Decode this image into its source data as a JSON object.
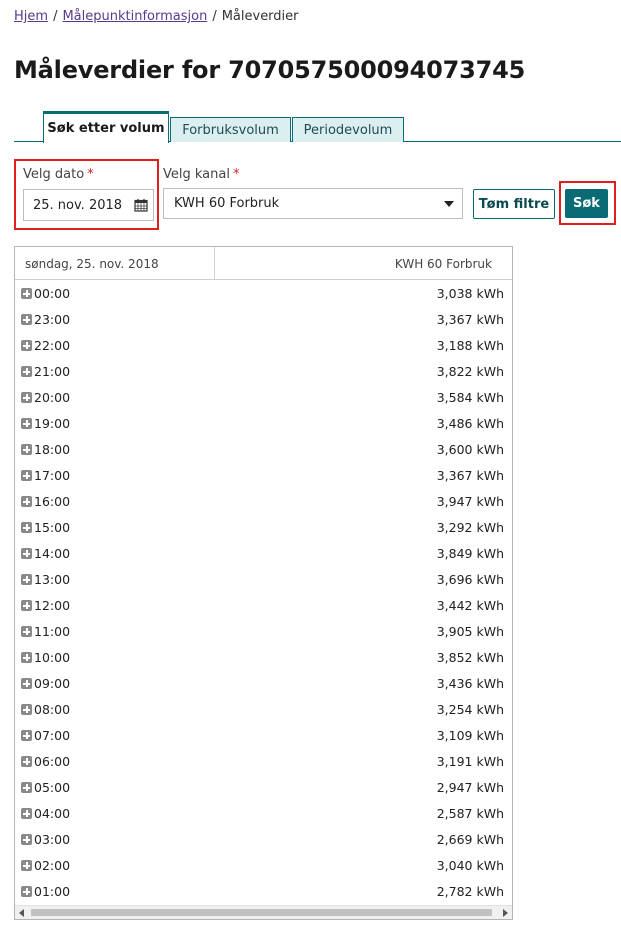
{
  "breadcrumb": {
    "items": [
      "Hjem",
      "Målepunktinformasjon"
    ],
    "current": "Måleverdier",
    "separator": "/"
  },
  "page_title": "Måleverdier for 707057500094073745",
  "tabs": [
    {
      "label": "Søk etter volum",
      "active": true
    },
    {
      "label": "Forbruksvolum",
      "active": false
    },
    {
      "label": "Periodevolum",
      "active": false
    }
  ],
  "filters": {
    "date_label": "Velg dato",
    "date_value": "25. nov. 2018",
    "channel_label": "Velg kanal",
    "channel_value": "KWH 60 Forbruk",
    "required_mark": "*",
    "clear_button": "Tøm filtre",
    "search_button": "Søk"
  },
  "table": {
    "date_header": "søndag, 25. nov. 2018",
    "channel_header": "KWH 60 Forbruk",
    "rows": [
      {
        "time": "00:00",
        "value": "3,038 kWh"
      },
      {
        "time": "23:00",
        "value": "3,367 kWh"
      },
      {
        "time": "22:00",
        "value": "3,188 kWh"
      },
      {
        "time": "21:00",
        "value": "3,822 kWh"
      },
      {
        "time": "20:00",
        "value": "3,584 kWh"
      },
      {
        "time": "19:00",
        "value": "3,486 kWh"
      },
      {
        "time": "18:00",
        "value": "3,600 kWh"
      },
      {
        "time": "17:00",
        "value": "3,367 kWh"
      },
      {
        "time": "16:00",
        "value": "3,947 kWh"
      },
      {
        "time": "15:00",
        "value": "3,292 kWh"
      },
      {
        "time": "14:00",
        "value": "3,849 kWh"
      },
      {
        "time": "13:00",
        "value": "3,696 kWh"
      },
      {
        "time": "12:00",
        "value": "3,442 kWh"
      },
      {
        "time": "11:00",
        "value": "3,905 kWh"
      },
      {
        "time": "10:00",
        "value": "3,852 kWh"
      },
      {
        "time": "09:00",
        "value": "3,436 kWh"
      },
      {
        "time": "08:00",
        "value": "3,254 kWh"
      },
      {
        "time": "07:00",
        "value": "3,109 kWh"
      },
      {
        "time": "06:00",
        "value": "3,191 kWh"
      },
      {
        "time": "05:00",
        "value": "2,947 kWh"
      },
      {
        "time": "04:00",
        "value": "2,587 kWh"
      },
      {
        "time": "03:00",
        "value": "2,669 kWh"
      },
      {
        "time": "02:00",
        "value": "3,040 kWh"
      },
      {
        "time": "01:00",
        "value": "2,782 kWh"
      }
    ]
  },
  "colors": {
    "primary": "#0a6b74",
    "tab_inactive_bg": "#dbeff1",
    "highlight": "#e0201f",
    "link": "#5a3a8a",
    "required": "#d21f1f"
  },
  "icons": {
    "date": "calendar-icon",
    "select": "chevron-down-icon",
    "row_expand": "plus-square-icon"
  }
}
